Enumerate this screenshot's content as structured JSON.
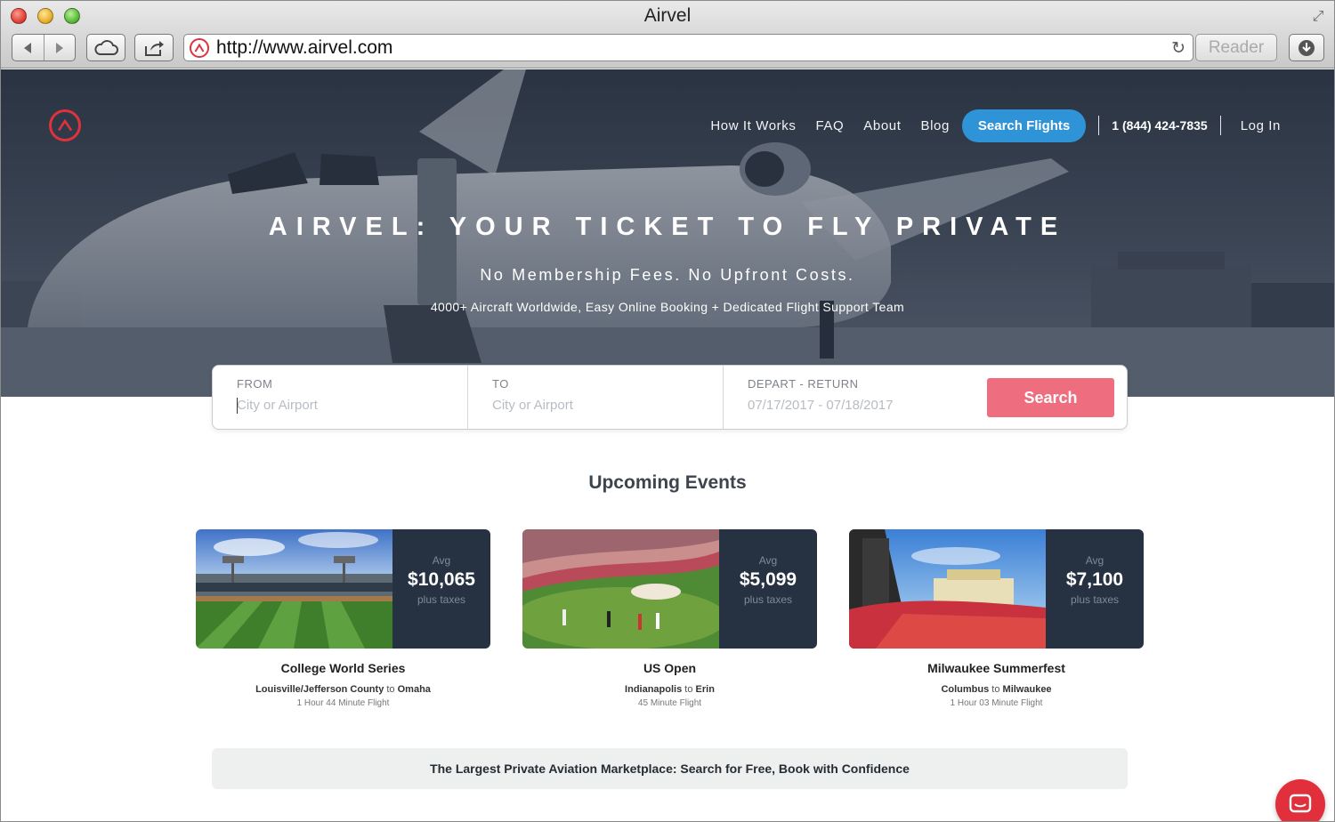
{
  "browser": {
    "window_title": "Airvel",
    "url": "http://www.airvel.com",
    "reader_label": "Reader"
  },
  "nav": {
    "links": [
      "How It Works",
      "FAQ",
      "About",
      "Blog"
    ],
    "cta_label": "Search Flights",
    "phone": "1 (844) 424-7835",
    "login": "Log In"
  },
  "hero": {
    "title": "AIRVEL: YOUR TICKET TO FLY PRIVATE",
    "subtitle": "No Membership Fees. No Upfront Costs.",
    "tagline": "4000+ Aircraft Worldwide, Easy Online Booking + Dedicated Flight Support Team"
  },
  "search": {
    "from_label": "FROM",
    "from_placeholder": "City or Airport",
    "to_label": "TO",
    "to_placeholder": "City or Airport",
    "dates_label": "DEPART - RETURN",
    "dates_value": "07/17/2017 - 07/18/2017",
    "button_label": "Search"
  },
  "events": {
    "title": "Upcoming Events",
    "items": [
      {
        "avg_label": "Avg",
        "price": "$10,065",
        "taxes": "plus taxes",
        "name": "College World Series",
        "from": "Louisville/Jefferson County",
        "connector": "to",
        "to": "Omaha",
        "duration": "1 Hour 44 Minute Flight"
      },
      {
        "avg_label": "Avg",
        "price": "$5,099",
        "taxes": "plus taxes",
        "name": "US Open",
        "from": "Indianapolis",
        "connector": "to",
        "to": "Erin",
        "duration": "45 Minute Flight"
      },
      {
        "avg_label": "Avg",
        "price": "$7,100",
        "taxes": "plus taxes",
        "name": "Milwaukee Summerfest",
        "from": "Columbus",
        "connector": "to",
        "to": "Milwaukee",
        "duration": "1 Hour 03 Minute Flight"
      }
    ]
  },
  "banner": {
    "text": "The Largest Private Aviation Marketplace: Search for Free, Book with Confidence"
  },
  "colors": {
    "brand_red": "#e0323c",
    "cta_blue": "#2f93d7",
    "search_button": "#ee6d7e",
    "price_panel": "#263241"
  },
  "icons": [
    "back-icon",
    "forward-icon",
    "cloud-icon",
    "share-icon",
    "reload-icon",
    "download-icon",
    "airvel-logo-icon",
    "chat-icon"
  ]
}
